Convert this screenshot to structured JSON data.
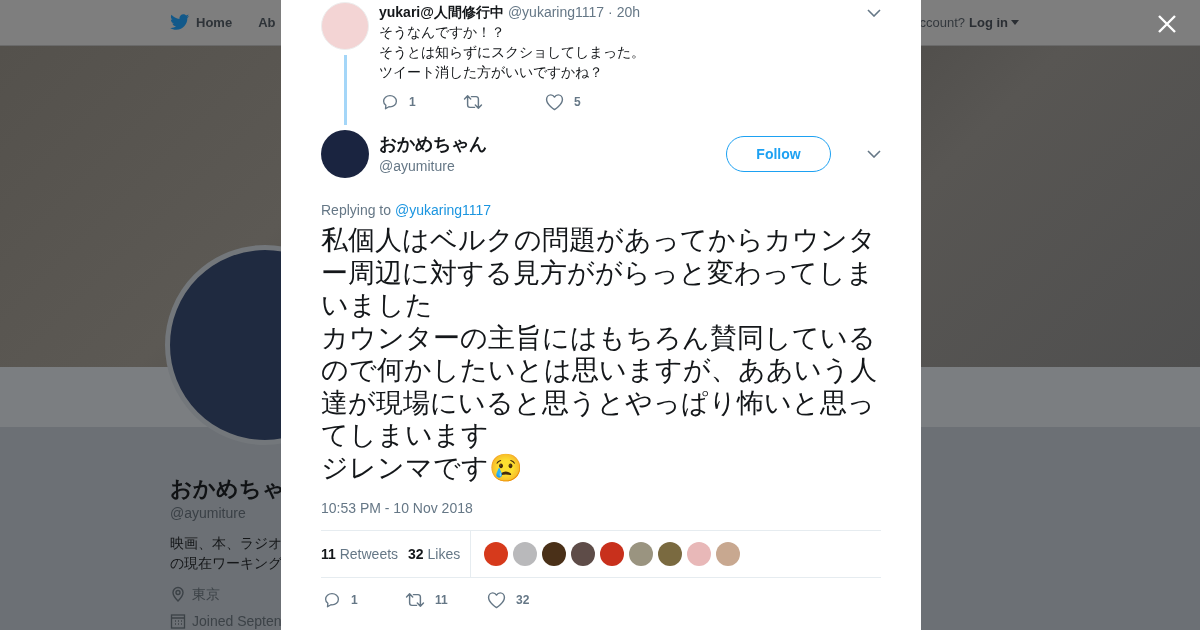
{
  "page": {
    "nav": [
      {
        "label": "Home"
      },
      {
        "label": "Ab"
      }
    ],
    "account_prompt": "ccount?",
    "login": "Log in",
    "profile": {
      "name": "おかめちゃ",
      "handle": "@ayumiture",
      "bio": [
        "映画、本、ラジオ",
        "の現在ワーキング"
      ],
      "location": "東京",
      "joined": "Joined Septen"
    }
  },
  "modal": {
    "parent_tweet": {
      "name": "yukari@人間修行中",
      "handle": "@yukaring1117",
      "time": "· 20h",
      "lines": [
        "そうなんですか！？",
        "そうとは知らずにスクショしてしまった。",
        "ツイート消した方がいいですかね？"
      ],
      "actions": [
        {
          "kind": "reply",
          "count": "1"
        },
        {
          "kind": "retweet"
        },
        {
          "kind": "like",
          "count": "5"
        }
      ]
    },
    "tweet": {
      "name": "おかめちゃん",
      "handle": "@ayumiture",
      "follow": "Follow",
      "replying_prefix": "Replying to",
      "replying_to": "@yukaring1117",
      "paragraphs": [
        "私個人はベルクの問題があってからカウンター周辺に対する見方ががらっと変わってしまいました",
        "カウンターの主旨にはもちろん賛同しているので何かしたいとは思いますが、ああいう人達が現場にいると思うとやっぱり怖いと思ってしまいます",
        "ジレンマです😢"
      ],
      "timestamp": "10:53 PM - 10 Nov 2018",
      "retweets_count": "11",
      "retweets_label": "Retweets",
      "likes_count": "32",
      "likes_label": "Likes",
      "likers": [
        {
          "color": "#d63a1c"
        },
        {
          "color": "#b9b9bb"
        },
        {
          "color": "#4a3018"
        },
        {
          "color": "#5e4c48"
        },
        {
          "color": "#c8301c"
        },
        {
          "color": "#9a9480"
        },
        {
          "color": "#7a6a40"
        },
        {
          "color": "#e8b8b8"
        },
        {
          "color": "#c8a890"
        }
      ],
      "actions": [
        {
          "kind": "reply",
          "count": "1"
        },
        {
          "kind": "retweet",
          "count": "11"
        },
        {
          "kind": "like",
          "count": "32"
        }
      ]
    }
  }
}
